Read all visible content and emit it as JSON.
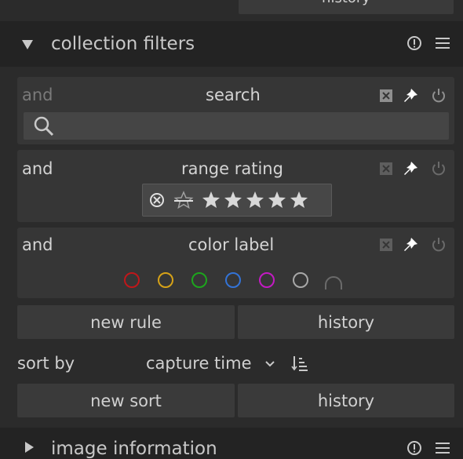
{
  "top_button": {
    "label": "history"
  },
  "collection_filters": {
    "title": "collection filters",
    "expanded": true
  },
  "filters": [
    {
      "operator": "and",
      "name": "search",
      "search_placeholder": ""
    },
    {
      "operator": "and",
      "name": "range rating",
      "rating_row": [
        "reject",
        "not-rated",
        "1",
        "2",
        "3",
        "4",
        "5"
      ]
    },
    {
      "operator": "and",
      "name": "color label",
      "colors": [
        "#c0171a",
        "#d6a218",
        "#1da51d",
        "#3373d6",
        "#c31ac3",
        "#a8a8a8"
      ]
    }
  ],
  "rule_buttons": {
    "new_rule": "new rule",
    "history": "history"
  },
  "sort": {
    "label": "sort by",
    "value": "capture time",
    "chevron": "⌄"
  },
  "sort_buttons": {
    "new_sort": "new sort",
    "history": "history"
  },
  "image_information": {
    "title": "image information",
    "expanded": false
  },
  "colors": {
    "bg": "#2b2b2b",
    "header_bg": "#232323",
    "card_bg": "#363636",
    "button_bg": "#3a3a3a",
    "text": "#c8c8c8",
    "muted": "#7a7a7a"
  }
}
